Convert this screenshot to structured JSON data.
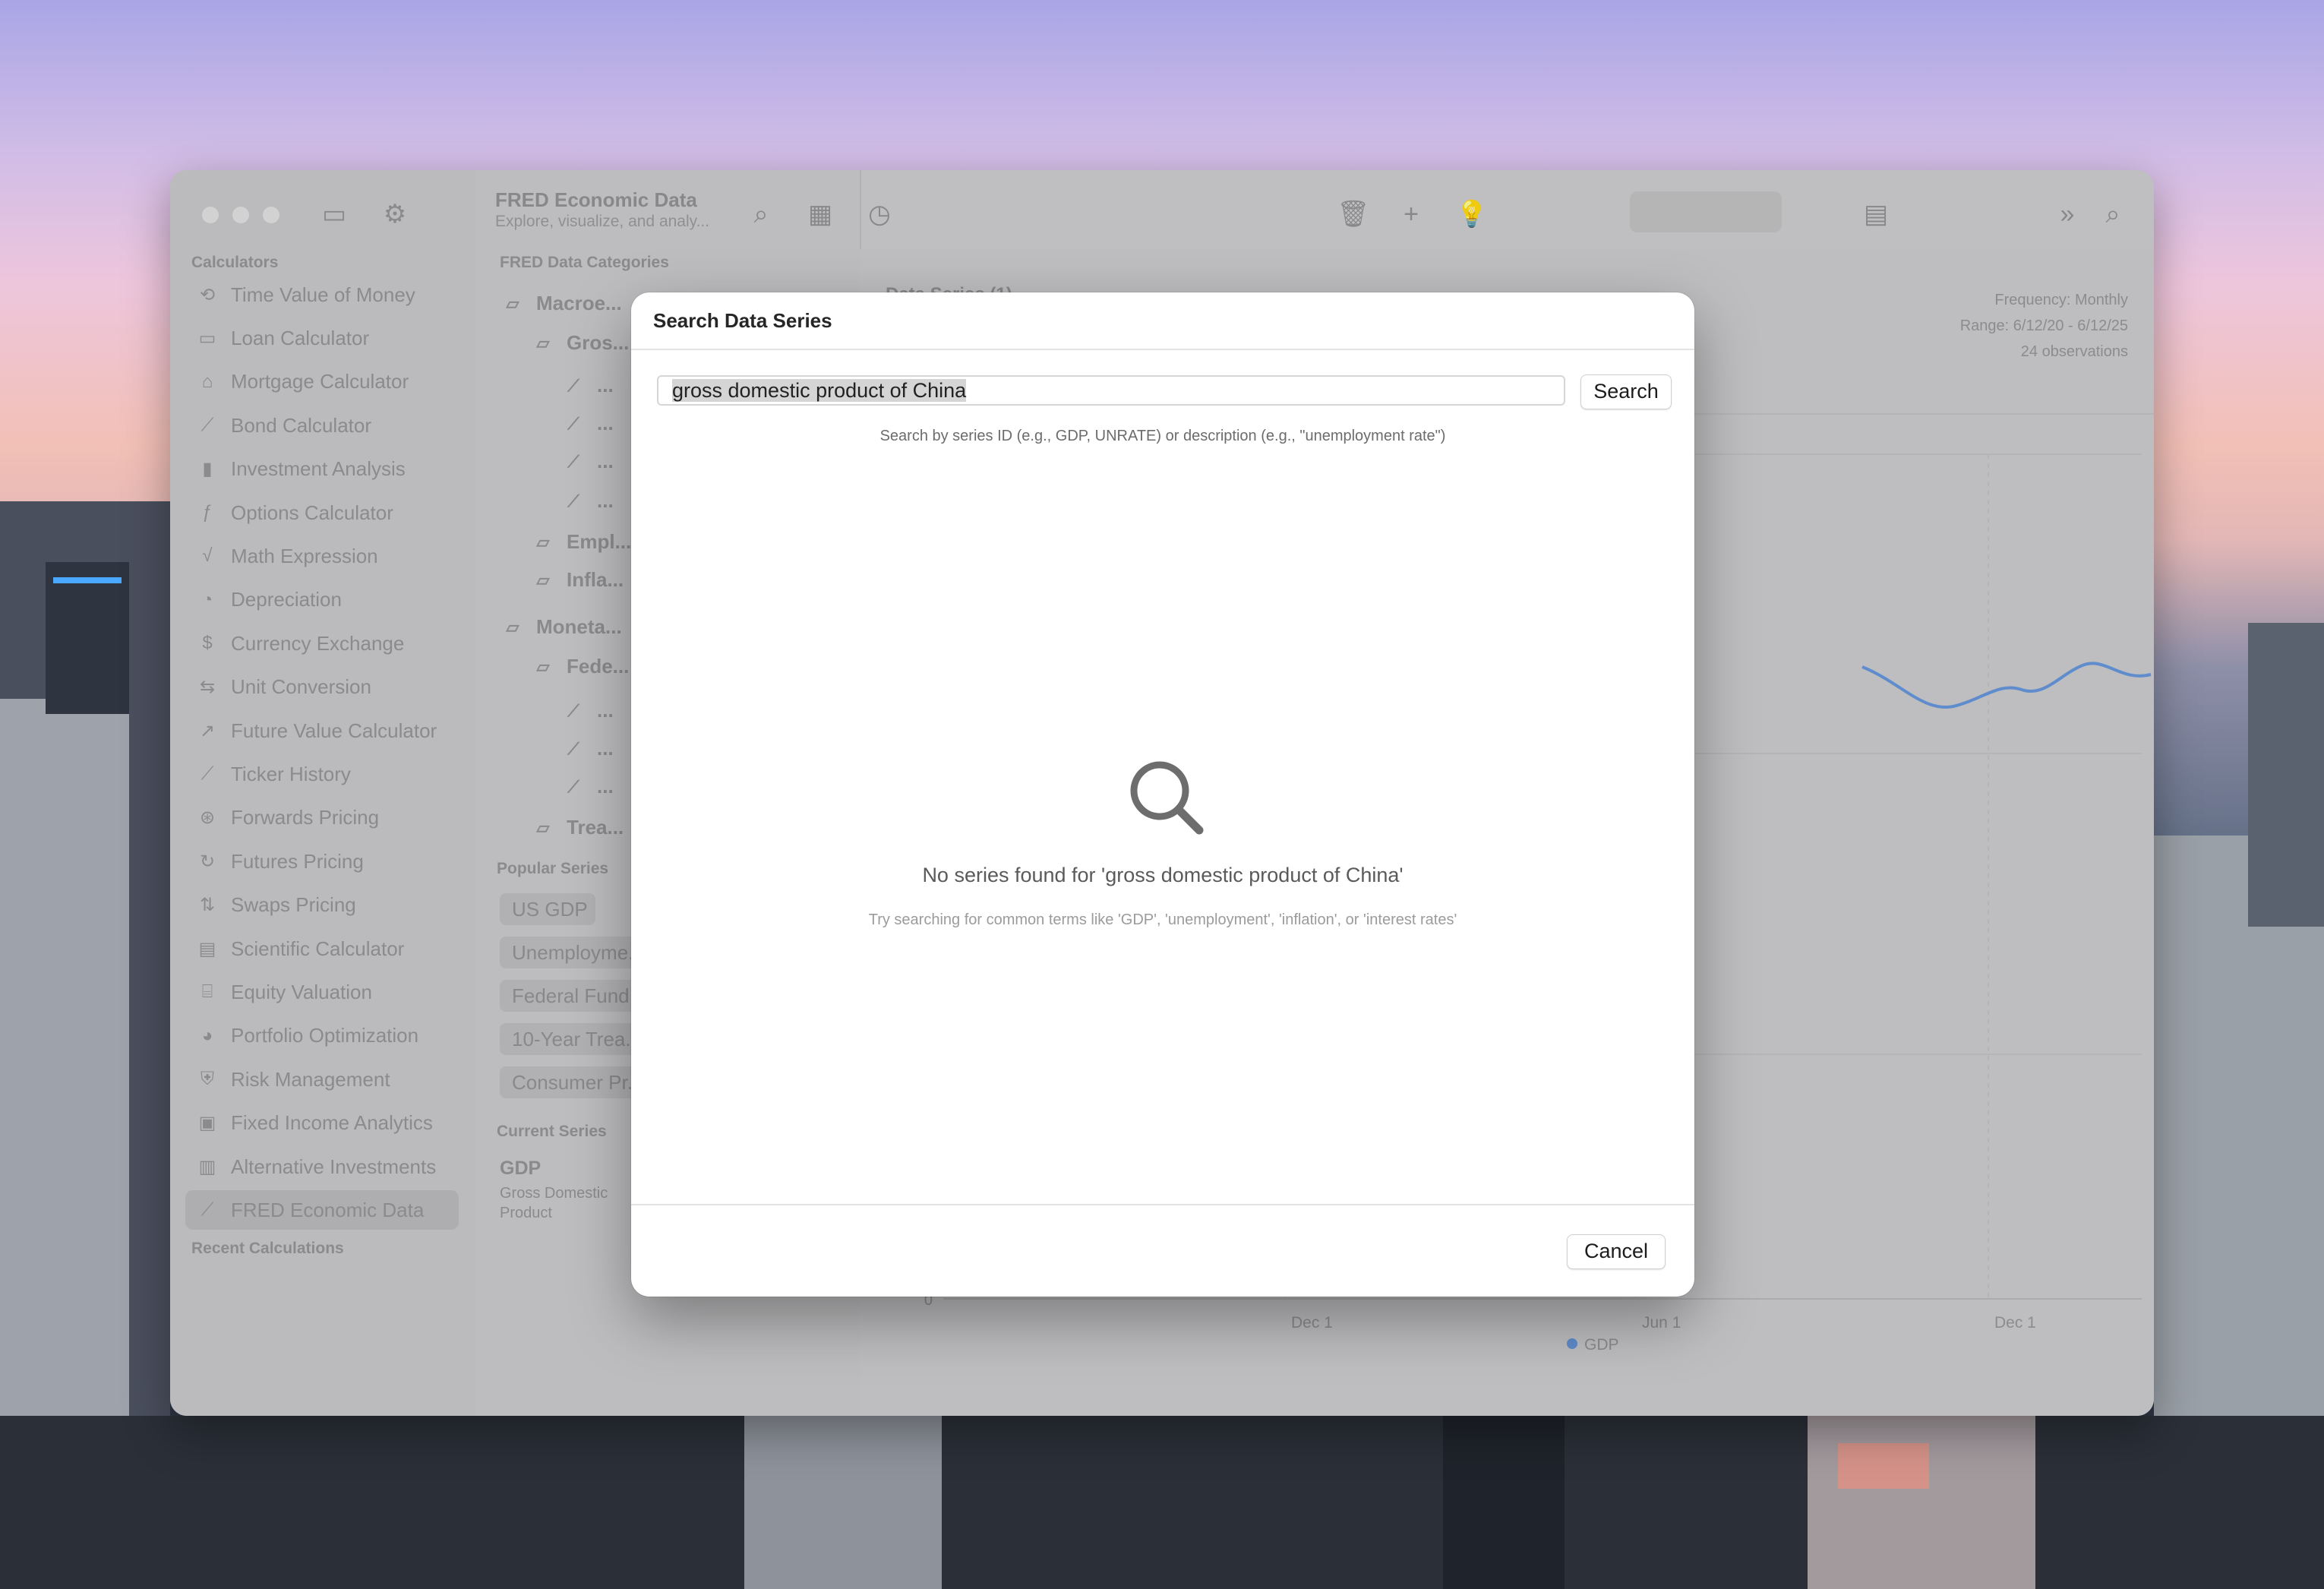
{
  "app": {
    "title": "FRED Economic Data",
    "subtitle": "Explore, visualize, and analy..."
  },
  "sidebar": {
    "section_calculators": "Calculators",
    "items": [
      {
        "label": "Time Value of Money",
        "icon": "clock-arrow-icon"
      },
      {
        "label": "Loan Calculator",
        "icon": "credit-card-icon"
      },
      {
        "label": "Mortgage Calculator",
        "icon": "house-icon"
      },
      {
        "label": "Bond Calculator",
        "icon": "line-chart-icon"
      },
      {
        "label": "Investment Analysis",
        "icon": "bar-chart-icon"
      },
      {
        "label": "Options Calculator",
        "icon": "function-icon"
      },
      {
        "label": "Math Expression",
        "icon": "sqrt-icon"
      },
      {
        "label": "Depreciation",
        "icon": "circle-arrow-icon"
      },
      {
        "label": "Currency Exchange",
        "icon": "dollar-circle-icon"
      },
      {
        "label": "Unit Conversion",
        "icon": "arrows-swap-icon"
      },
      {
        "label": "Future Value Calculator",
        "icon": "trend-up-icon"
      },
      {
        "label": "Ticker History",
        "icon": "line-chart-icon"
      },
      {
        "label": "Forwards Pricing",
        "icon": "arrow-circle-icon"
      },
      {
        "label": "Futures Pricing",
        "icon": "clock-forward-icon"
      },
      {
        "label": "Swaps Pricing",
        "icon": "swap-icon"
      },
      {
        "label": "Scientific Calculator",
        "icon": "calculator-icon"
      },
      {
        "label": "Equity Valuation",
        "icon": "bank-icon"
      },
      {
        "label": "Portfolio Optimization",
        "icon": "pie-chart-icon"
      },
      {
        "label": "Risk Management",
        "icon": "shield-icon"
      },
      {
        "label": "Fixed Income Analytics",
        "icon": "clipboard-icon"
      },
      {
        "label": "Alternative Investments",
        "icon": "building-icon"
      },
      {
        "label": "FRED Economic Data",
        "icon": "line-chart-icon"
      }
    ],
    "section_recent": "Recent Calculations"
  },
  "categories": {
    "header": "FRED Data Categories",
    "tree": [
      {
        "label": "Macroe...",
        "level": 0,
        "icon": "folder-icon"
      },
      {
        "label": "Gros...",
        "level": 1,
        "icon": "folder-icon"
      },
      {
        "label": "...",
        "level": 2,
        "icon": "line-chart-icon"
      },
      {
        "label": "...",
        "level": 2,
        "icon": "line-chart-icon"
      },
      {
        "label": "...",
        "level": 2,
        "icon": "line-chart-icon"
      },
      {
        "label": "...",
        "level": 2,
        "icon": "line-chart-icon"
      },
      {
        "label": "Empl...",
        "level": 1,
        "icon": "folder-icon"
      },
      {
        "label": "Infla...",
        "level": 1,
        "icon": "folder-icon"
      },
      {
        "label": "Moneta...",
        "level": 0,
        "icon": "folder-icon"
      },
      {
        "label": "Fede...",
        "level": 1,
        "icon": "folder-icon"
      },
      {
        "label": "...",
        "level": 2,
        "icon": "line-chart-icon"
      },
      {
        "label": "...",
        "level": 2,
        "icon": "line-chart-icon"
      },
      {
        "label": "...",
        "level": 2,
        "icon": "line-chart-icon"
      },
      {
        "label": "Trea...",
        "level": 1,
        "icon": "folder-icon"
      }
    ],
    "popular_header": "Popular Series",
    "popular": [
      "US GDP",
      "Unemployme...",
      "Federal Fund...",
      "10-Year Trea...",
      "Consumer Pr..."
    ],
    "current_header": "Current Series",
    "current_id": "GDP",
    "current_name": "Gross Domestic Product"
  },
  "main": {
    "series_header": "Data Series (1)",
    "frequency": "Frequency: Monthly",
    "range": "Range: 6/12/20 - 6/12/25",
    "observations": "24 observations",
    "x_ticks": [
      "Dec 1",
      "Jun 1",
      "Dec 1"
    ],
    "y_zero": "0",
    "legend": "GDP",
    "series_color": "#5b8fd8"
  },
  "modal": {
    "title": "Search Data Series",
    "query": "gross domestic product of China",
    "search_button": "Search",
    "hint": "Search by series ID (e.g., GDP, UNRATE) or description (e.g., \"unemployment rate\")",
    "empty_message": "No series found for 'gross domestic product of China'",
    "empty_tip": "Try searching for common terms like 'GDP', 'unemployment', 'inflation', or 'interest rates'",
    "cancel_button": "Cancel"
  }
}
